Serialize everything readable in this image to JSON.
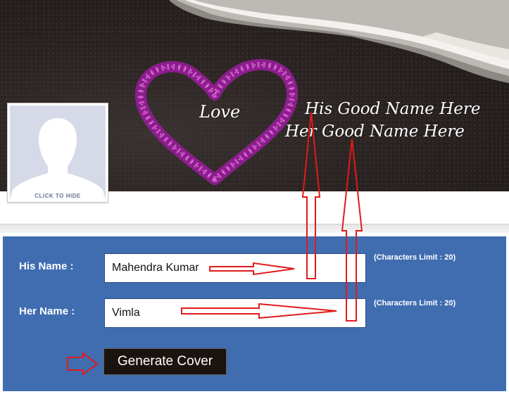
{
  "cover": {
    "love_text": "Love",
    "his_preview": "His Good Name Here",
    "her_preview": "Her Good Name Here"
  },
  "profile": {
    "caption": "CLICK TO HIDE",
    "icon": "silhouette-avatar"
  },
  "form": {
    "his_label": "His Name :",
    "his_value": "Mahendra Kumar",
    "his_limit": "(Characters Limit : 20)",
    "her_label": "Her Name :",
    "her_value": "Vimla",
    "her_limit": "(Characters Limit : 20)",
    "generate_label": "Generate Cover"
  },
  "colors": {
    "panel": "#3f6db0",
    "annotation_arrow": "#e01b1b",
    "button": "#1b130f"
  }
}
